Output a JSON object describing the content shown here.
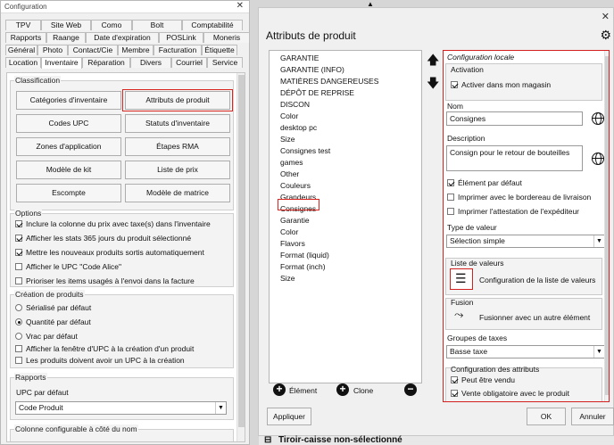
{
  "config_window": {
    "title": "Configuration",
    "tabs_row1": [
      "TPV",
      "Site Web",
      "Como",
      "Bolt",
      "Comptabilité"
    ],
    "tabs_row2": [
      "Rapports",
      "Raange",
      "Date d'expiration",
      "POSLink",
      "Moneris"
    ],
    "tabs_row3": [
      "Général",
      "Photo",
      "Contact/Cie",
      "Membre",
      "Facturation",
      "Étiquette"
    ],
    "tabs_row4": [
      "Location",
      "Inventaire",
      "Réparation",
      "Divers",
      "Courriel",
      "Service"
    ],
    "classification": {
      "title": "Classification",
      "buttons": [
        "Catégories d'inventaire",
        "Attributs de produit",
        "Codes UPC",
        "Statuts d'inventaire",
        "Zones d'application",
        "Étapes RMA",
        "Modèle de kit",
        "Liste de prix",
        "Escompte",
        "Modèle de matrice"
      ]
    },
    "options": {
      "title": "Options",
      "items": [
        {
          "label": "Inclure la colonne du prix avec taxe(s) dans l'inventaire",
          "checked": true
        },
        {
          "label": "Afficher les stats 365 jours du produit sélectionné",
          "checked": true
        },
        {
          "label": "Mettre les nouveaux produits sortis automatiquement",
          "checked": true
        },
        {
          "label": "Afficher le UPC \"Code Alice\"",
          "checked": false
        },
        {
          "label": "Prioriser les items usagés à l'envoi dans la facture",
          "checked": false
        }
      ]
    },
    "creation": {
      "title": "Création de produits",
      "radios": [
        {
          "label": "Sérialisé par défaut",
          "checked": false
        },
        {
          "label": "Quantité par défaut",
          "checked": true
        },
        {
          "label": "Vrac par défaut",
          "checked": false
        }
      ],
      "checks": [
        {
          "label": "Afficher la fenêtre d'UPC à la création d'un produit",
          "checked": false
        },
        {
          "label": "Les produits doivent avoir un UPC à la création",
          "checked": false
        }
      ]
    },
    "reports": {
      "title": "Rapports",
      "upc_label": "UPC par défaut",
      "upc_value": "Code Produit"
    },
    "next_group_title": "Colonne configurable à côté du nom"
  },
  "attr_dialog": {
    "title": "Attributs de produit",
    "items": [
      "GARANTIE",
      "GARANTIE (INFO)",
      "MATIÈRES DANGEREUSES",
      "DÉPÔT DE REPRISE",
      "DISCON",
      "Color",
      "desktop pc",
      "Size",
      "Consignes test",
      "games",
      "Other",
      "Couleurs",
      "Grandeurs",
      "Consignes",
      "Garantie",
      "Color",
      "Flavors",
      "Format (liquid)",
      "Format (inch)",
      "Size"
    ],
    "selected_item": "Consignes",
    "add_label": "Élément",
    "clone_label": "Clone",
    "apply_label": "Appliquer",
    "ok_label": "OK",
    "cancel_label": "Annuler",
    "local_config_title": "Configuration locale",
    "activation": {
      "title": "Activation",
      "label": "Activer dans mon magasin",
      "checked": true
    },
    "name_label": "Nom",
    "name_value": "Consignes",
    "description_label": "Description",
    "description_value": "Consign pour le retour de bouteilles",
    "checks": [
      {
        "label": "Élément par défaut",
        "checked": true
      },
      {
        "label": "Imprimer avec le bordereau de livraison",
        "checked": false
      },
      {
        "label": "Imprimer l'attestation de l'expéditeur",
        "checked": false
      }
    ],
    "value_type_label": "Type de valeur",
    "value_type": "Sélection simple",
    "value_list": {
      "title": "Liste de valeurs",
      "button": "Configuration de la liste de valeurs"
    },
    "merge": {
      "title": "Fusion",
      "button": "Fusionner avec un autre élément"
    },
    "tax_group_label": "Groupes de taxes",
    "tax_group_value": "Basse taxe",
    "attr_config": {
      "title": "Configuration des attributs",
      "items": [
        {
          "label": "Peut être vendu",
          "checked": true
        },
        {
          "label": "Vente obligatoire avec le produit",
          "checked": true
        }
      ]
    }
  },
  "bottom_bar": {
    "label": "Tiroir-caisse non-sélectionné"
  }
}
